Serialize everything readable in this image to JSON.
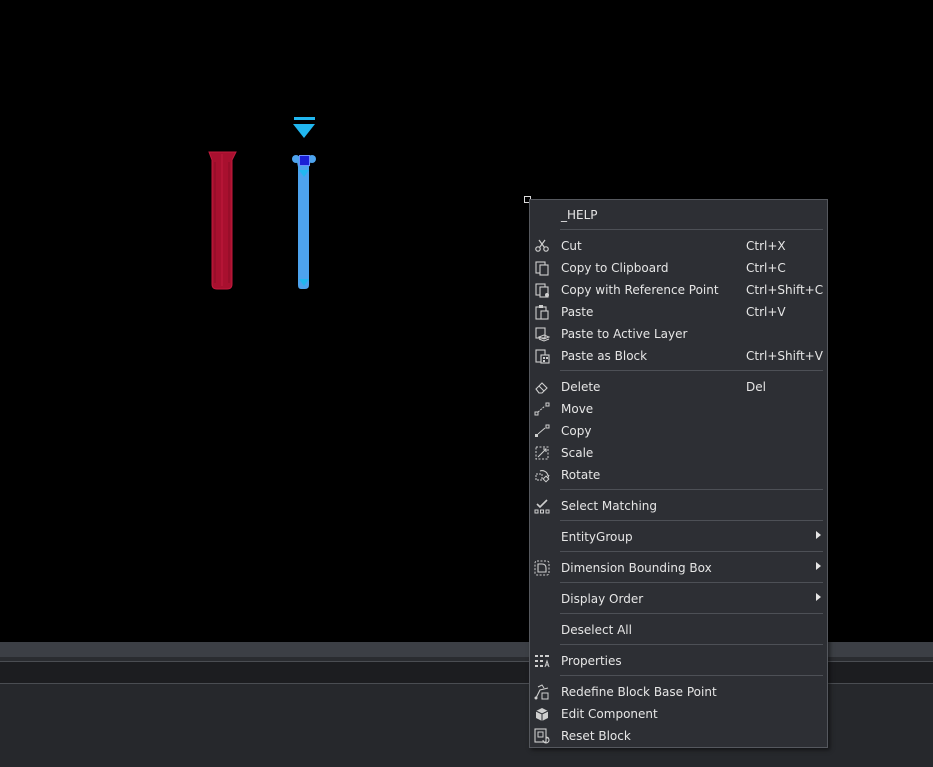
{
  "menu": {
    "help": "_HELP",
    "clipboard": [
      {
        "label": "Cut",
        "shortcut": "Ctrl+X",
        "icon": "scissors-icon"
      },
      {
        "label": "Copy to Clipboard",
        "shortcut": "Ctrl+C",
        "icon": "copy-clipboard-icon"
      },
      {
        "label": "Copy with Reference Point",
        "shortcut": "Ctrl+Shift+C",
        "icon": "copy-reference-icon"
      },
      {
        "label": "Paste",
        "shortcut": "Ctrl+V",
        "icon": "paste-icon"
      },
      {
        "label": "Paste to Active Layer",
        "shortcut": "",
        "icon": "paste-layer-icon"
      },
      {
        "label": "Paste as Block",
        "shortcut": "Ctrl+Shift+V",
        "icon": "paste-block-icon"
      }
    ],
    "modify": [
      {
        "label": "Delete",
        "shortcut": "Del",
        "icon": "eraser-icon"
      },
      {
        "label": "Move",
        "shortcut": "",
        "icon": "move-icon"
      },
      {
        "label": "Copy",
        "shortcut": "",
        "icon": "copy-icon"
      },
      {
        "label": "Scale",
        "shortcut": "",
        "icon": "scale-icon"
      },
      {
        "label": "Rotate",
        "shortcut": "",
        "icon": "rotate-icon"
      }
    ],
    "select_matching": "Select Matching",
    "entity_group": "EntityGroup",
    "dimension_bounding_box": "Dimension Bounding Box",
    "display_order": "Display Order",
    "deselect_all": "Deselect All",
    "properties": "Properties",
    "block": [
      {
        "label": "Redefine Block Base Point",
        "icon": "redefine-base-point-icon"
      },
      {
        "label": "Edit Component",
        "icon": "edit-component-icon"
      },
      {
        "label": "Reset Block",
        "icon": "reset-block-icon"
      }
    ]
  },
  "colors": {
    "canvas": "#000000",
    "menu_bg": "#2d2f34",
    "menu_text": "#e6e6e6",
    "red_object": "#a8102f",
    "blue_object": "#4da3ee",
    "grip_blue": "#1b1fd6",
    "marker_cyan": "#21b7f0"
  }
}
